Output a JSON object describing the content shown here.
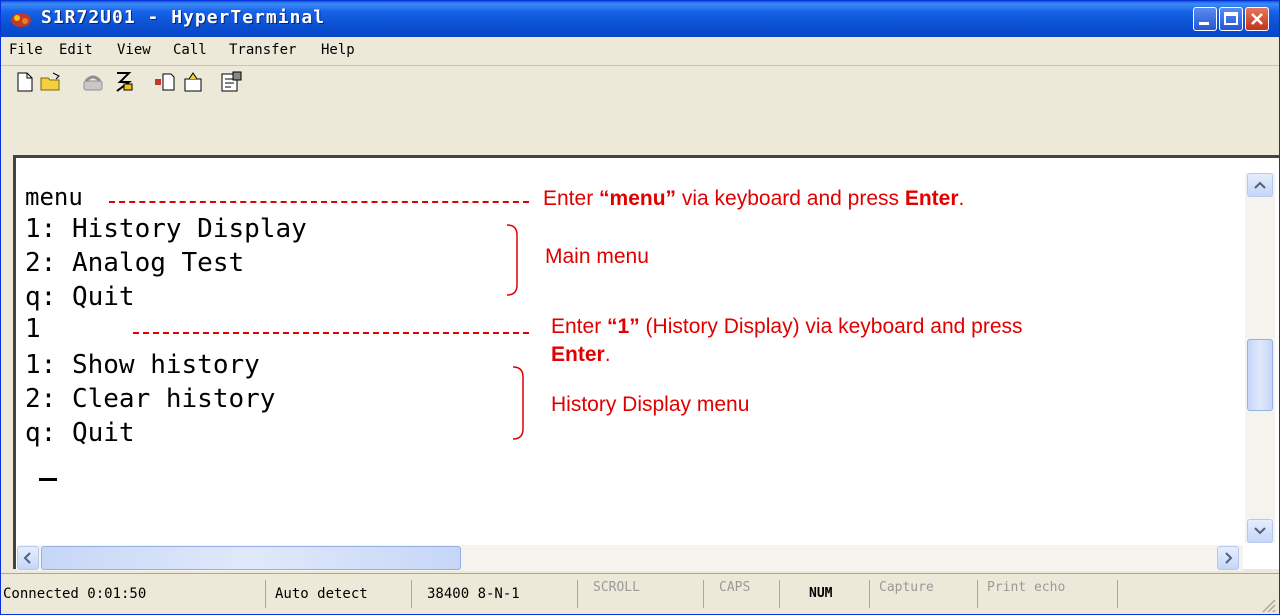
{
  "window": {
    "title": "S1R72U01 - HyperTerminal"
  },
  "menubar": [
    {
      "label": "File"
    },
    {
      "label": "Edit"
    },
    {
      "label": "View"
    },
    {
      "label": "Call"
    },
    {
      "label": "Transfer"
    },
    {
      "label": "Help"
    }
  ],
  "terminal": {
    "lines": [
      "menu",
      "1: History Display",
      "2: Analog Test",
      "q: Quit",
      "1",
      "1: Show history",
      "2: Clear history",
      "q: Quit"
    ]
  },
  "annotations": {
    "a1_pre": "Enter ",
    "a1_bold": "“menu”",
    "a1_mid": " via keyboard and press ",
    "a1_bold2": "Enter",
    "a1_end": ".",
    "main_menu": "Main menu",
    "a2_pre": "Enter ",
    "a2_bold": "“1”",
    "a2_mid": " (History Display) via keyboard and press",
    "a2_bold2": "Enter",
    "a2_end": ".",
    "history_menu": "History Display menu"
  },
  "statusbar": {
    "connected": "Connected 0:01:50",
    "detect": "Auto detect",
    "settings": "38400 8-N-1",
    "scroll": "SCROLL",
    "caps": "CAPS",
    "num": "NUM",
    "capture": "Capture",
    "echo": "Print echo"
  },
  "colors": {
    "annotation": "#e00000",
    "titlebar": "#0a4fd0"
  }
}
